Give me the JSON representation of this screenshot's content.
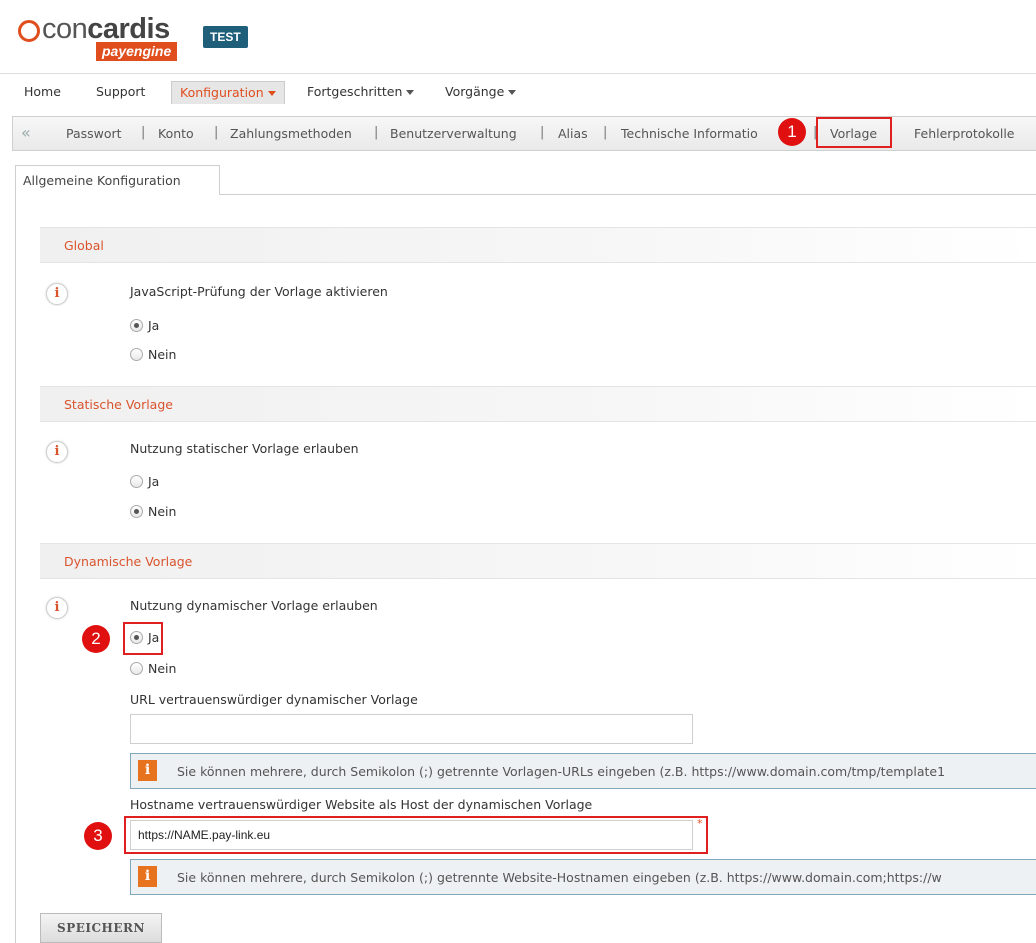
{
  "header": {
    "logo_main": "con",
    "logo_main_bold": "cardis",
    "logo_sub": "payengine",
    "env_badge": "TEST"
  },
  "main_nav": {
    "items": [
      {
        "label": "Home"
      },
      {
        "label": "Support"
      },
      {
        "label": "Konfiguration",
        "active": true
      },
      {
        "label": "Fortgeschritten"
      },
      {
        "label": "Vorgänge"
      }
    ]
  },
  "sub_nav": {
    "back_glyph": "«",
    "separator": "|",
    "items": [
      {
        "label": "Passwort"
      },
      {
        "label": "Konto"
      },
      {
        "label": "Zahlungsmethoden"
      },
      {
        "label": "Benutzerverwaltung"
      },
      {
        "label": "Alias"
      },
      {
        "label": "Technische Informatio"
      },
      {
        "label": "Vorlage",
        "active": true
      },
      {
        "label": "Fehlerprotokolle"
      }
    ]
  },
  "tab": {
    "label": "Allgemeine Konfiguration"
  },
  "sections": {
    "global": {
      "title": "Global",
      "question": "JavaScript-Prüfung der Vorlage aktivieren",
      "options": [
        "Ja",
        "Nein"
      ],
      "selected": "Ja"
    },
    "static": {
      "title": "Statische Vorlage",
      "question": "Nutzung statischer Vorlage erlauben",
      "options": [
        "Ja",
        "Nein"
      ],
      "selected": "Nein"
    },
    "dynamic": {
      "title": "Dynamische Vorlage",
      "question": "Nutzung dynamischer Vorlage erlauben",
      "options": [
        "Ja",
        "Nein"
      ],
      "selected": "Ja",
      "url_label": "URL vertrauenswürdiger dynamischer Vorlage",
      "url_value": "",
      "url_hint": "Sie können mehrere, durch Semikolon (;) getrennte Vorlagen-URLs eingeben (z.B. https://www.domain.com/tmp/template1",
      "host_label": "Hostname vertrauenswürdiger Website als Host der dynamischen Vorlage",
      "host_value": "https://NAME.pay-link.eu",
      "host_required": "*",
      "host_hint": "Sie können mehrere, durch Semikolon (;) getrennte Website-Hostnamen eingeben (z.B. https://www.domain.com;https://w"
    }
  },
  "info_glyph": "i",
  "hint_glyph": "i",
  "save_button": "SPEICHERN",
  "annotations": [
    "1",
    "2",
    "3"
  ],
  "colors": {
    "accent": "#e04e1e",
    "section_title": "#d9532c",
    "badge": "#1f5f7a",
    "annotation": "#e01010",
    "hint_border": "#7fa8bd"
  }
}
